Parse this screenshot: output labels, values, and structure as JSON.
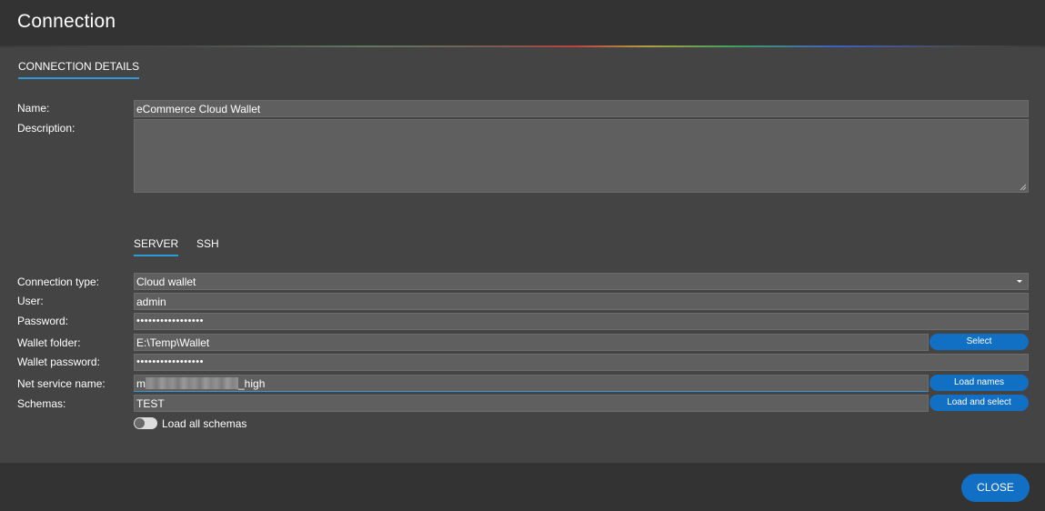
{
  "window": {
    "title": "Connection"
  },
  "tabs": {
    "main": "CONNECTION DETAILS",
    "server": "SERVER",
    "ssh": "SSH"
  },
  "form": {
    "name_label": "Name:",
    "name_value": "eCommerce Cloud Wallet",
    "description_label": "Description:",
    "description_value": "",
    "connection_type_label": "Connection type:",
    "connection_type_value": "Cloud wallet",
    "user_label": "User:",
    "user_value": "admin",
    "password_label": "Password:",
    "password_value": "•••••••••••••••••",
    "wallet_folder_label": "Wallet folder:",
    "wallet_folder_value": "E:\\Temp\\Wallet",
    "wallet_password_label": "Wallet password:",
    "wallet_password_value": "•••••••••••••••••",
    "net_service_label": "Net service name:",
    "net_service_prefix": "m",
    "net_service_suffix": "_high",
    "schemas_label": "Schemas:",
    "schemas_value": "TEST",
    "load_all_label": "Load all schemas",
    "load_all_enabled": false
  },
  "buttons": {
    "select": "Select",
    "load_names": "Load names",
    "load_and_select": "Load and select",
    "close": "CLOSE"
  },
  "colors": {
    "accent": "#1170c4",
    "tab_underline": "#2f9ad6"
  }
}
